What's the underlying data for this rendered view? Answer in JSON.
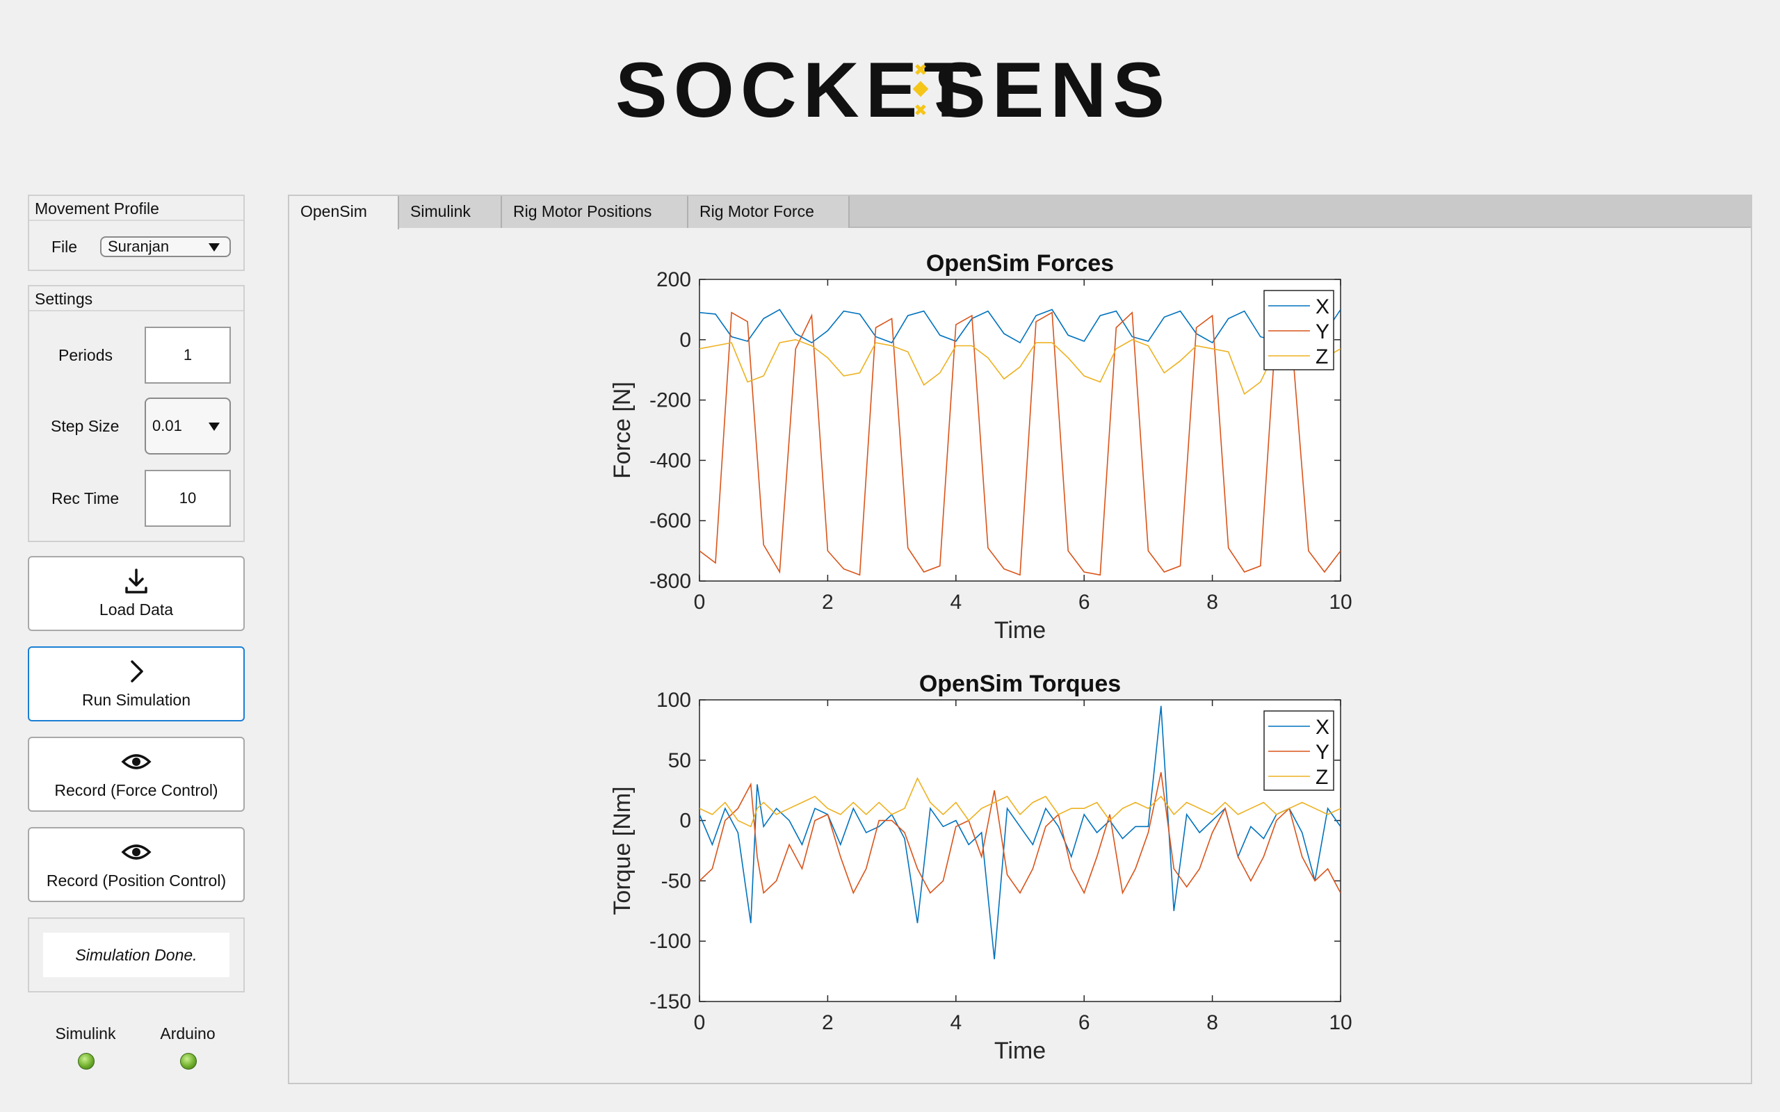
{
  "brand": {
    "name_left": "SOCKET",
    "name_right": "SENSE",
    "accent": "#f5c518"
  },
  "movement_profile": {
    "title": "Movement Profile",
    "file_label": "File",
    "file_value": "Suranjan"
  },
  "settings": {
    "title": "Settings",
    "periods_label": "Periods",
    "periods_value": "1",
    "step_label": "Step Size",
    "step_value": "0.01",
    "rec_label": "Rec Time",
    "rec_value": "10"
  },
  "buttons": {
    "load": "Load Data",
    "run": "Run Simulation",
    "rec_force": "Record (Force Control)",
    "rec_pos": "Record (Position Control)"
  },
  "status": {
    "text": "Simulation Done."
  },
  "indicators": {
    "simulink": "Simulink",
    "arduino": "Arduino",
    "led_color": "#6fae2c"
  },
  "tabs": [
    {
      "label": "OpenSim",
      "selected": true
    },
    {
      "label": "Simulink",
      "selected": false
    },
    {
      "label": "Rig Motor Positions",
      "selected": false
    },
    {
      "label": "Rig Motor Force",
      "selected": false
    }
  ],
  "series_colors": {
    "X": "#0072bd",
    "Y": "#d95319",
    "Z": "#edb120"
  },
  "chart_data": [
    {
      "type": "line",
      "title": "OpenSim Forces",
      "xlabel": "Time",
      "ylabel": "Force [N]",
      "xlim": [
        0,
        10
      ],
      "ylim": [
        -800,
        200
      ],
      "xticks": [
        0,
        2,
        4,
        6,
        8,
        10
      ],
      "yticks": [
        -800,
        -600,
        -400,
        -200,
        0,
        200
      ],
      "legend": "top-right",
      "grid": false,
      "x": [
        0,
        0.25,
        0.5,
        0.75,
        1,
        1.25,
        1.5,
        1.75,
        2,
        2.25,
        2.5,
        2.75,
        3,
        3.25,
        3.5,
        3.75,
        4,
        4.25,
        4.5,
        4.75,
        5,
        5.25,
        5.5,
        5.75,
        6,
        6.25,
        6.5,
        6.75,
        7,
        7.25,
        7.5,
        7.75,
        8,
        8.25,
        8.5,
        8.75,
        9,
        9.25,
        9.5,
        9.75,
        10
      ],
      "series": [
        {
          "name": "X",
          "values": [
            90,
            85,
            10,
            -5,
            70,
            100,
            20,
            -10,
            30,
            95,
            85,
            10,
            -10,
            80,
            95,
            15,
            -5,
            70,
            95,
            20,
            -10,
            80,
            100,
            15,
            -5,
            80,
            95,
            10,
            -5,
            75,
            95,
            20,
            -10,
            70,
            95,
            10,
            -5,
            80,
            95,
            20,
            100
          ]
        },
        {
          "name": "Y",
          "values": [
            -700,
            -740,
            90,
            60,
            -680,
            -770,
            -30,
            80,
            -700,
            -760,
            -780,
            40,
            70,
            -690,
            -770,
            -750,
            50,
            80,
            -690,
            -760,
            -780,
            60,
            90,
            -700,
            -770,
            -780,
            40,
            90,
            -700,
            -770,
            -750,
            40,
            80,
            -690,
            -770,
            -750,
            60,
            -30,
            -700,
            -770,
            -700
          ]
        },
        {
          "name": "Z",
          "values": [
            -30,
            -20,
            -10,
            -140,
            -120,
            -10,
            0,
            -20,
            -60,
            -120,
            -110,
            -10,
            -20,
            -40,
            -150,
            -110,
            -20,
            -20,
            -60,
            -130,
            -90,
            -10,
            -10,
            -60,
            -120,
            -140,
            -30,
            0,
            -20,
            -110,
            -70,
            -20,
            -30,
            -40,
            -180,
            -140,
            -30,
            -40,
            -90,
            -60,
            -30
          ]
        }
      ]
    },
    {
      "type": "line",
      "title": "OpenSim Torques",
      "xlabel": "Time",
      "ylabel": "Torque [Nm]",
      "xlim": [
        0,
        10
      ],
      "ylim": [
        -150,
        100
      ],
      "xticks": [
        0,
        2,
        4,
        6,
        8,
        10
      ],
      "yticks": [
        -150,
        -100,
        -50,
        0,
        50,
        100
      ],
      "legend": "top-right",
      "grid": false,
      "x": [
        0,
        0.2,
        0.4,
        0.6,
        0.8,
        0.9,
        1,
        1.2,
        1.4,
        1.6,
        1.8,
        2,
        2.2,
        2.4,
        2.6,
        2.8,
        3,
        3.2,
        3.4,
        3.6,
        3.8,
        4,
        4.2,
        4.4,
        4.6,
        4.8,
        5,
        5.2,
        5.4,
        5.6,
        5.8,
        6,
        6.2,
        6.4,
        6.6,
        6.8,
        7,
        7.2,
        7.4,
        7.6,
        7.8,
        8,
        8.2,
        8.4,
        8.6,
        8.8,
        9,
        9.2,
        9.4,
        9.6,
        9.8,
        10
      ],
      "series": [
        {
          "name": "X",
          "values": [
            5,
            -20,
            10,
            -10,
            -85,
            30,
            -5,
            10,
            0,
            -20,
            10,
            5,
            -20,
            10,
            -10,
            -5,
            5,
            -15,
            -85,
            10,
            -5,
            0,
            -20,
            -10,
            -115,
            10,
            -5,
            -20,
            10,
            -5,
            -30,
            5,
            -10,
            0,
            -15,
            -5,
            -5,
            95,
            -75,
            5,
            -10,
            0,
            10,
            -30,
            -5,
            -15,
            5,
            10,
            -10,
            -50,
            10,
            -5
          ]
        },
        {
          "name": "Y",
          "values": [
            -50,
            -40,
            0,
            10,
            30,
            -30,
            -60,
            -50,
            -20,
            -40,
            0,
            5,
            -30,
            -60,
            -40,
            0,
            0,
            -10,
            -40,
            -60,
            -50,
            -5,
            0,
            -30,
            25,
            -45,
            -60,
            -40,
            -5,
            5,
            -40,
            -60,
            -30,
            5,
            -60,
            -40,
            -10,
            40,
            -40,
            -55,
            -40,
            -10,
            10,
            -30,
            -50,
            -30,
            0,
            10,
            -30,
            -50,
            -40,
            -60
          ]
        },
        {
          "name": "Z",
          "values": [
            10,
            5,
            15,
            0,
            -5,
            10,
            15,
            5,
            10,
            15,
            20,
            10,
            5,
            15,
            5,
            15,
            5,
            10,
            35,
            15,
            5,
            15,
            0,
            10,
            15,
            20,
            5,
            15,
            20,
            5,
            10,
            10,
            15,
            0,
            10,
            15,
            10,
            20,
            5,
            15,
            10,
            5,
            15,
            5,
            10,
            15,
            5,
            10,
            15,
            10,
            5,
            10
          ]
        }
      ]
    }
  ]
}
